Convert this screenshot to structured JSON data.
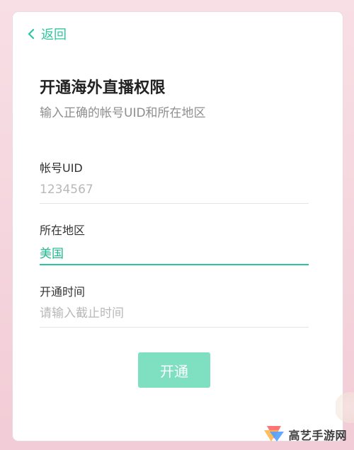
{
  "nav": {
    "back_label": "返回"
  },
  "header": {
    "title": "开通海外直播权限",
    "subtitle": "输入正确的帐号UID和所在地区"
  },
  "form": {
    "uid": {
      "label": "帐号UID",
      "placeholder": "1234567",
      "value": ""
    },
    "region": {
      "label": "所在地区",
      "value": "美国"
    },
    "deadline": {
      "label": "开通时间",
      "placeholder": "请输入截止时间",
      "value": ""
    },
    "submit_label": "开通"
  },
  "watermark": {
    "text": "高艺手游网"
  },
  "colors": {
    "accent": "#29c59f",
    "button": "#7fe0c1",
    "background": "#f3d3db"
  }
}
